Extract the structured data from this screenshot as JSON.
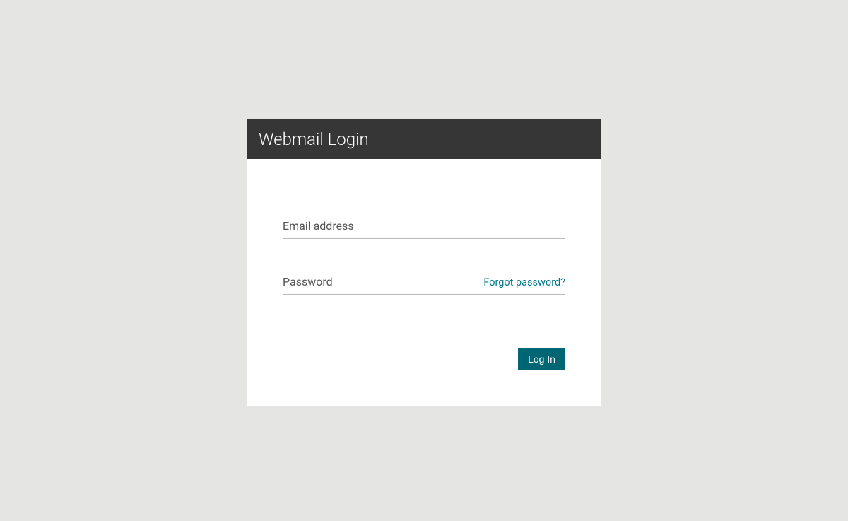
{
  "header": {
    "title": "Webmail Login"
  },
  "form": {
    "email_label": "Email address",
    "email_value": "",
    "password_label": "Password",
    "password_value": "",
    "forgot_link": "Forgot password?",
    "submit_label": "Log In"
  },
  "colors": {
    "header_bg": "#363636",
    "accent": "#006673",
    "link": "#007a87",
    "page_bg": "#e5e5e3"
  }
}
